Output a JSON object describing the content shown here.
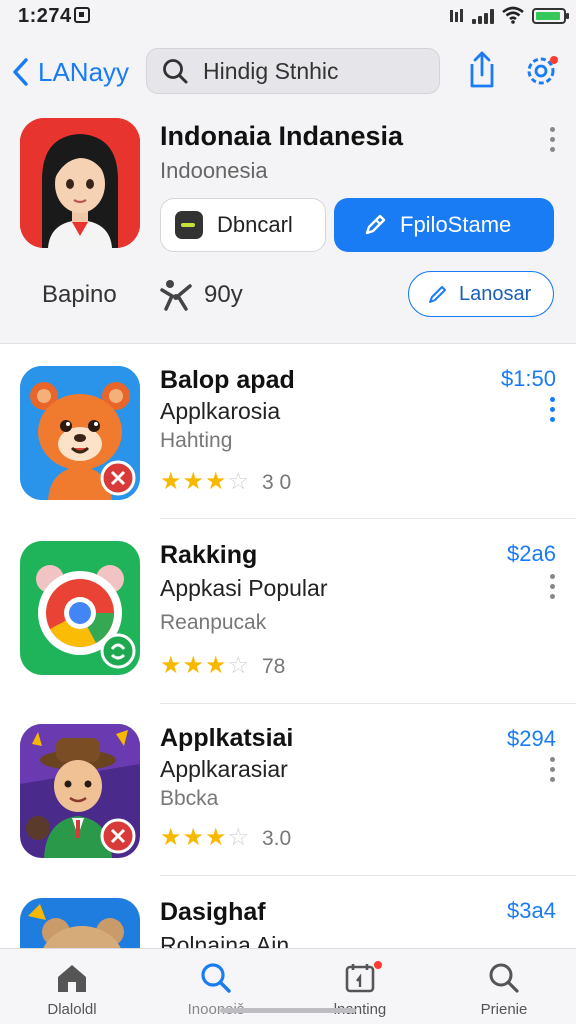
{
  "status_bar": {
    "time": "1:274",
    "signal_text": " ǀǂ"
  },
  "nav": {
    "back_label": "LANayy",
    "search_placeholder": "Hindig Stnhic",
    "share_icon": "share-icon",
    "settings_icon": "settings-icon"
  },
  "featured": {
    "title": "Indonaia Indanesia",
    "subtitle": "Indoonesia",
    "download_label": "Dbncarl",
    "primary_label": "FpiloStame",
    "meta_left": "Bapino",
    "meta_right": "90y",
    "outline_label": "Lanosar"
  },
  "apps": [
    {
      "name": "Balop apad",
      "category": "Applkarosia",
      "developer": "Hahting",
      "stars_filled": 3,
      "stars_total": 5,
      "rating_text": "3 0",
      "price": "$1:50",
      "price_color": "#1a7cf5"
    },
    {
      "name": "Rakking",
      "category": "Appkasi Popular",
      "developer": "Reanpucak",
      "stars_filled": 3,
      "stars_total": 5,
      "rating_text": "78",
      "price": "$2a6",
      "price_color": "#1a7cf5"
    },
    {
      "name": "Applkatsiai",
      "category": "Applkarasiar",
      "developer": "Bbcka",
      "stars_filled": 3,
      "stars_total": 5,
      "rating_text": "3.0",
      "price": "$294",
      "price_color": "#1a7cf5"
    },
    {
      "name": "Dasighaf",
      "category": "Rolnaina Ain",
      "developer": "",
      "stars_filled": 0,
      "stars_total": 0,
      "rating_text": "",
      "price": "$3a4",
      "price_color": "#1a7cf5"
    }
  ],
  "tabs": [
    {
      "label": "Dlaloldl",
      "icon": "home-icon"
    },
    {
      "label": "Inooneiš",
      "icon": "search-icon"
    },
    {
      "label": "lnanting",
      "icon": "calendar-icon"
    },
    {
      "label": "Prienie",
      "icon": "search-icon"
    }
  ],
  "colors": {
    "accent": "#1a7cf5",
    "star": "#f6b900",
    "featured_icon_bg": "#e8342f"
  }
}
